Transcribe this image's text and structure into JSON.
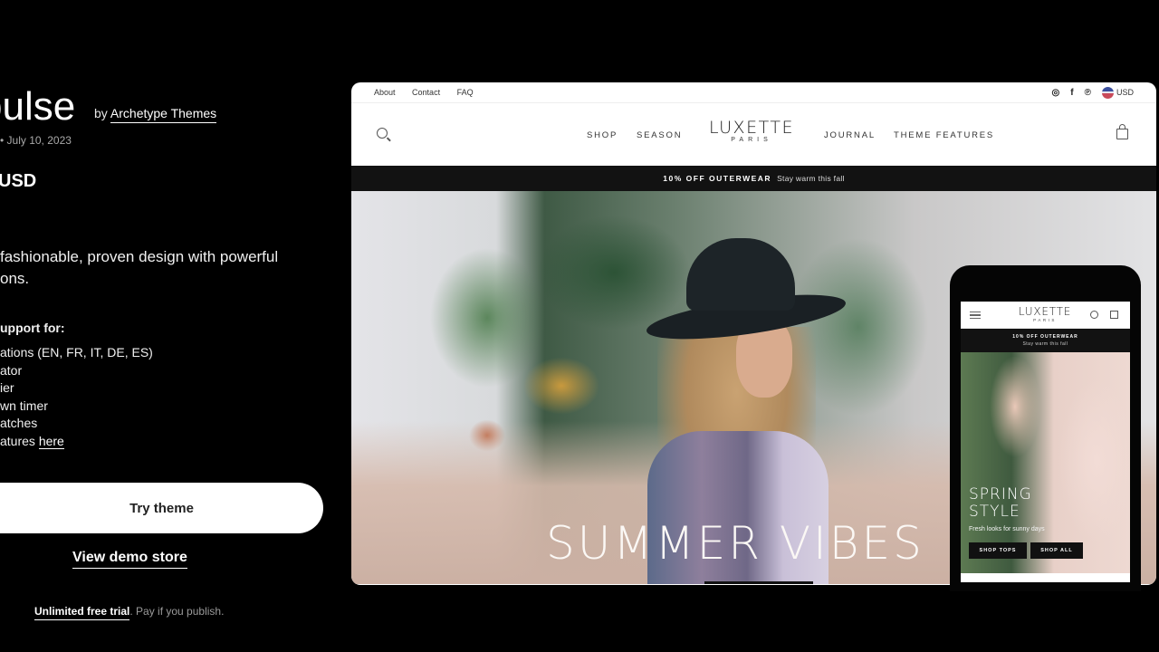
{
  "theme": {
    "name_partial": "pulse",
    "by_prefix": "by",
    "author": "Archetype Themes",
    "meta_partial": "• July 10, 2023",
    "price_partial": "USD",
    "description": "fashionable, proven design with powerful ons.",
    "description_lines": [
      "fashionable, proven design with powerful",
      "ons."
    ],
    "support_heading": "upport for:",
    "support_items": [
      "ations (EN, FR, IT, DE, ES)",
      "ator",
      "ier",
      "wn timer",
      "atches"
    ],
    "features_prefix": "atures ",
    "features_link": "here",
    "try_button": "Try theme",
    "demo_link": "View demo store",
    "trial_link": "Unlimited free trial",
    "trial_suffix": ". Pay if you publish."
  },
  "desktop_preview": {
    "top_links": [
      "About",
      "Contact",
      "FAQ"
    ],
    "social_icons": [
      "instagram-icon",
      "facebook-icon",
      "pinterest-icon"
    ],
    "currency": "USD",
    "nav_left": [
      "SHOP",
      "SEASON"
    ],
    "nav_right": [
      "JOURNAL",
      "THEME FEATURES"
    ],
    "logo_main": "LUXETTE",
    "logo_sub": "PARIS",
    "announcement_bold": "10% OFF OUTERWEAR",
    "announcement_text": "Stay warm this fall",
    "hero_title": "SUMMER VIBES"
  },
  "mobile_preview": {
    "logo_main": "LUXETTE",
    "logo_sub": "PARIS",
    "announcement_bold": "10% OFF OUTERWEAR",
    "announcement_text": "Stay warm this fall",
    "hero_title_line1": "SPRING",
    "hero_title_line2": "STYLE",
    "hero_subtitle": "Fresh looks for sunny days",
    "buttons": [
      "SHOP TOPS",
      "SHOP ALL"
    ]
  }
}
